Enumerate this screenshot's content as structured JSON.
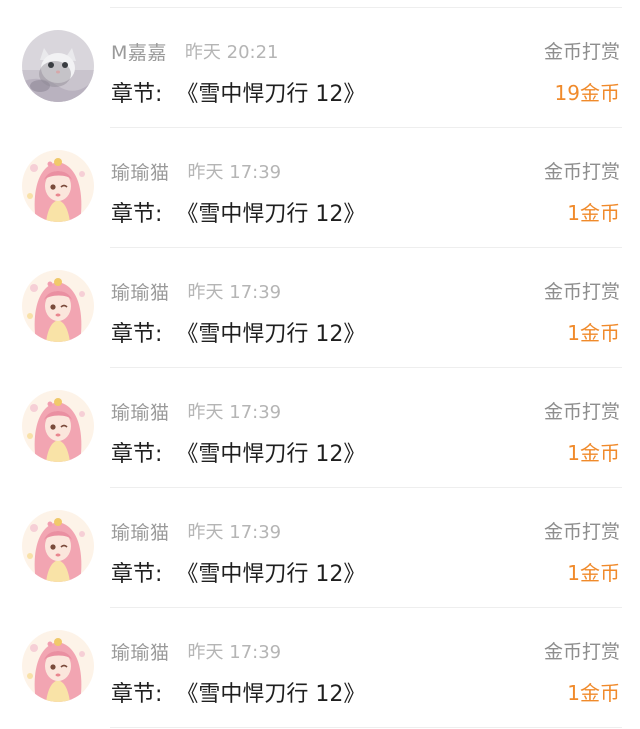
{
  "colors": {
    "accent": "#f08a2b",
    "username": "#9a9a9a",
    "time": "#b5b5b5",
    "reward_type": "#8e8e8e"
  },
  "rows": [
    {
      "username": "M嘉嘉",
      "time": "昨天 20:21",
      "chapter_label": "章节:",
      "chapter_title": "《雪中悍刀行 12》",
      "reward_type": "金币打赏",
      "amount": "19金币",
      "avatar": "cat-avatar"
    },
    {
      "username": "瑜瑜猫",
      "time": "昨天 17:39",
      "chapter_label": "章节:",
      "chapter_title": "《雪中悍刀行 12》",
      "reward_type": "金币打赏",
      "amount": "1金币",
      "avatar": "anime-girl-avatar"
    },
    {
      "username": "瑜瑜猫",
      "time": "昨天 17:39",
      "chapter_label": "章节:",
      "chapter_title": "《雪中悍刀行 12》",
      "reward_type": "金币打赏",
      "amount": "1金币",
      "avatar": "anime-girl-avatar"
    },
    {
      "username": "瑜瑜猫",
      "time": "昨天 17:39",
      "chapter_label": "章节:",
      "chapter_title": "《雪中悍刀行 12》",
      "reward_type": "金币打赏",
      "amount": "1金币",
      "avatar": "anime-girl-avatar"
    },
    {
      "username": "瑜瑜猫",
      "time": "昨天 17:39",
      "chapter_label": "章节:",
      "chapter_title": "《雪中悍刀行 12》",
      "reward_type": "金币打赏",
      "amount": "1金币",
      "avatar": "anime-girl-avatar"
    },
    {
      "username": "瑜瑜猫",
      "time": "昨天 17:39",
      "chapter_label": "章节:",
      "chapter_title": "《雪中悍刀行 12》",
      "reward_type": "金币打赏",
      "amount": "1金币",
      "avatar": "anime-girl-avatar"
    }
  ]
}
